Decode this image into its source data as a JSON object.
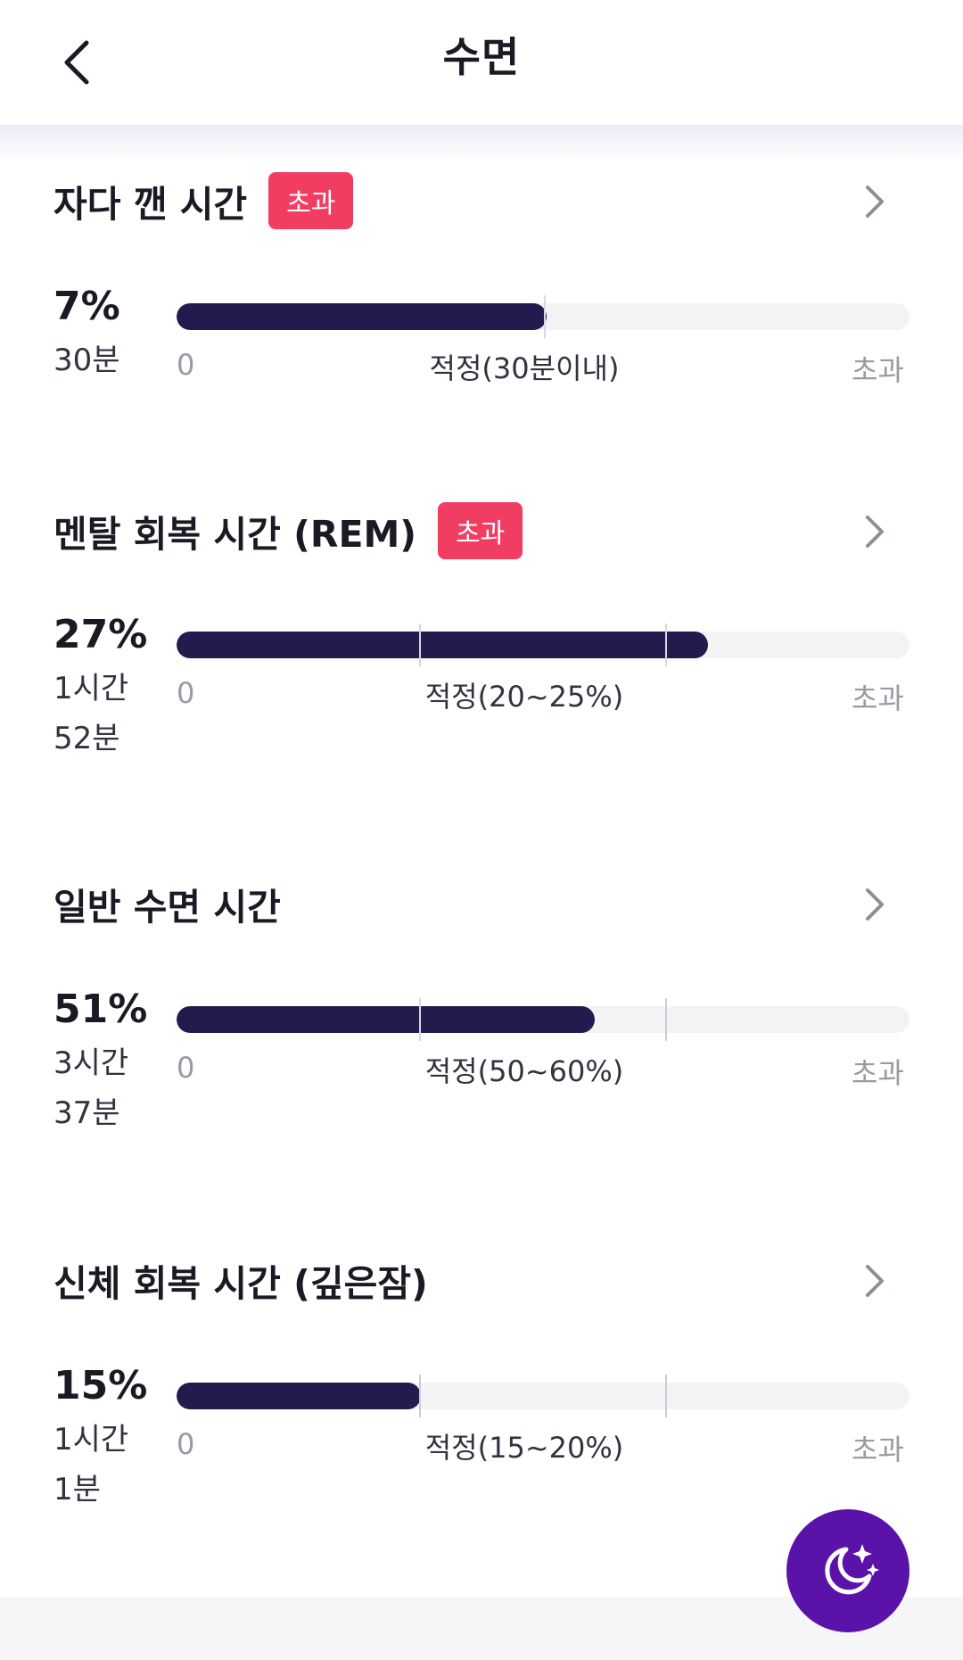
{
  "header": {
    "title": "수면",
    "back_icon": "chevron-left-icon"
  },
  "sections": [
    {
      "title": "자다 깬 시간",
      "badge": "초과",
      "percent": "7%",
      "duration_line1": "30분",
      "duration_line2": "",
      "fill_fraction": 0.505,
      "scale_min": "0",
      "scale_mid": "적정(30분이내)",
      "scale_max": "초과"
    },
    {
      "title": "멘탈 회복 시간 (REM)",
      "badge": "초과",
      "percent": "27%",
      "duration_line1": "1시간",
      "duration_line2": "52분",
      "fill_fraction": 0.725,
      "scale_min": "0",
      "scale_mid": "적정(20~25%)",
      "scale_max": "초과"
    },
    {
      "title": "일반 수면 시간",
      "badge": "",
      "percent": "51%",
      "duration_line1": "3시간",
      "duration_line2": "37분",
      "fill_fraction": 0.57,
      "scale_min": "0",
      "scale_mid": "적정(50~60%)",
      "scale_max": "초과"
    },
    {
      "title": "신체 회복 시간 (깊은잠)",
      "badge": "",
      "percent": "15%",
      "duration_line1": "1시간",
      "duration_line2": "1분",
      "fill_fraction": 0.333,
      "scale_min": "0",
      "scale_mid": "적정(15~20%)",
      "scale_max": "초과"
    }
  ],
  "fab": {
    "icon": "moon-stars-icon"
  },
  "colors": {
    "bar_fill": "#221b4d",
    "bar_track": "#f3f3f5",
    "badge": "#f23d63",
    "fab": "#5a12a8"
  }
}
